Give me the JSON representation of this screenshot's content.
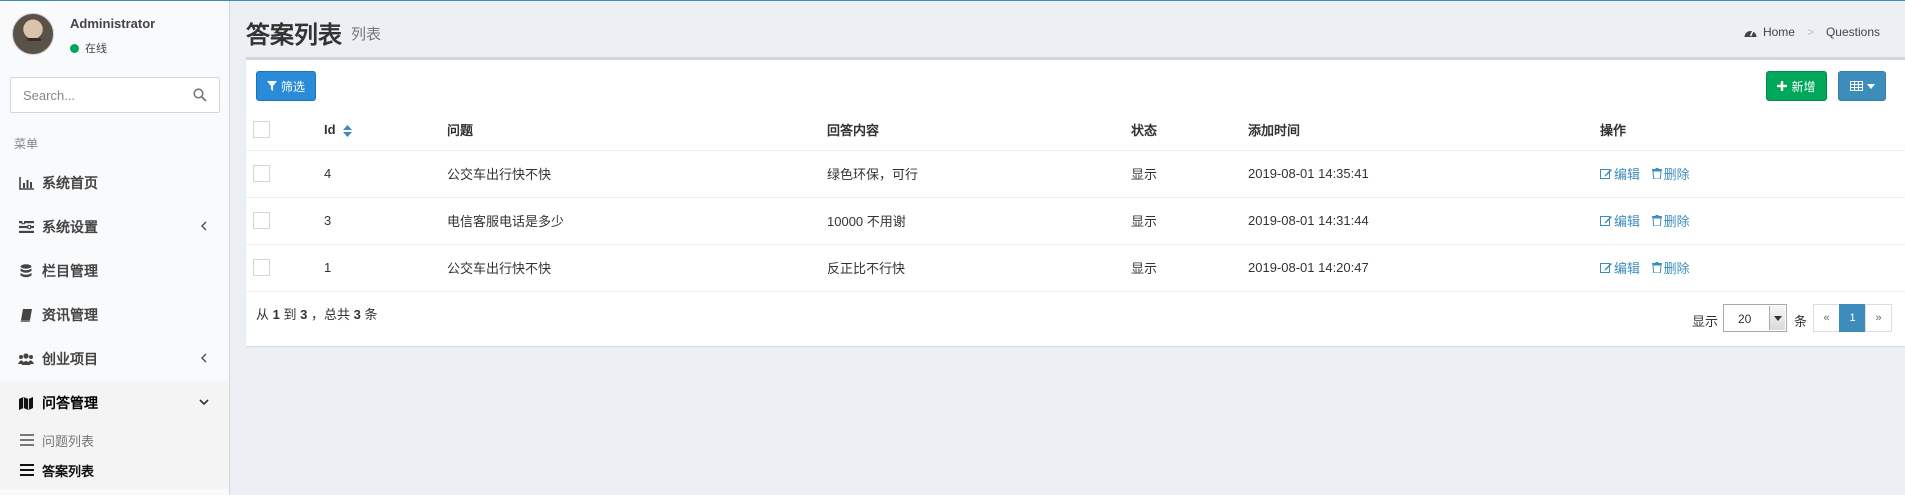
{
  "user": {
    "name": "Administrator",
    "status": "在线"
  },
  "search": {
    "placeholder": "Search..."
  },
  "menu": {
    "header": "菜单",
    "items": [
      {
        "label": "系统首页",
        "icon": "bar-chart-icon"
      },
      {
        "label": "系统设置",
        "icon": "list-settings-icon",
        "caret": "chevron-left-icon"
      },
      {
        "label": "栏目管理",
        "icon": "database-icon"
      },
      {
        "label": "资讯管理",
        "icon": "book-icon"
      },
      {
        "label": "创业项目",
        "icon": "users-icon",
        "caret": "chevron-left-icon"
      },
      {
        "label": "问答管理",
        "icon": "map-icon",
        "caret": "chevron-down-icon"
      }
    ],
    "subitems": [
      {
        "label": "问题列表",
        "icon": "list-icon"
      },
      {
        "label": "答案列表",
        "icon": "list-icon"
      }
    ]
  },
  "header": {
    "title": "答案列表",
    "subtitle": "列表"
  },
  "breadcrumb": {
    "home": "Home",
    "current": "Questions"
  },
  "toolbar": {
    "filter_label": "筛选",
    "add_label": "新增"
  },
  "table": {
    "headers": {
      "id": "Id",
      "question": "问题",
      "answer": "回答内容",
      "status": "状态",
      "time": "添加时间",
      "ops": "操作"
    },
    "rows": [
      {
        "id": "4",
        "question": "公交车出行快不快",
        "answer": "绿色环保，可行",
        "status": "显示",
        "time": "2019-08-01 14:35:41"
      },
      {
        "id": "3",
        "question": "电信客服电话是多少",
        "answer": "10000 不用谢",
        "status": "显示",
        "time": "2019-08-01 14:31:44"
      },
      {
        "id": "1",
        "question": "公交车出行快不快",
        "answer": "反正比不行快",
        "status": "显示",
        "time": "2019-08-01 14:20:47"
      }
    ],
    "edit_label": "编辑",
    "delete_label": "删除"
  },
  "summary": {
    "prefix": "从",
    "from": "1",
    "to_word": "到",
    "to": "3",
    "mid": "，总共",
    "total": "3",
    "suffix": "条"
  },
  "pager": {
    "show_label": "显示",
    "page_size": "20",
    "unit_label": "条",
    "prev": "«",
    "current": "1",
    "next": "»"
  },
  "colors": {
    "primary": "#3c8dbc",
    "success": "#00a65a",
    "filter": "#2a8cd8",
    "online": "#00a65a"
  }
}
